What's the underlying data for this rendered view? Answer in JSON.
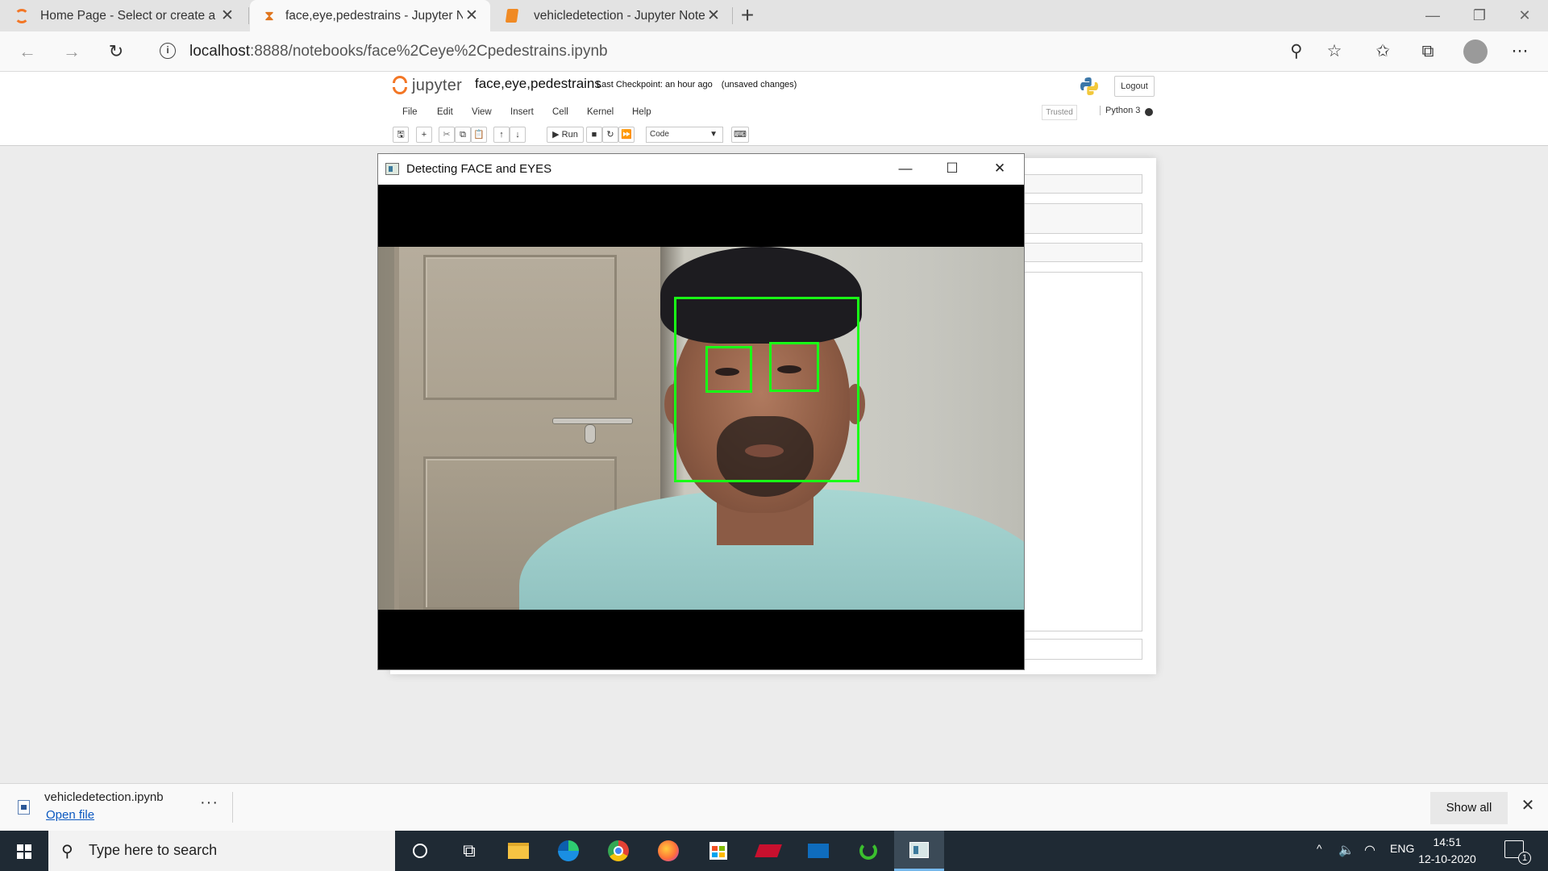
{
  "browser": {
    "tabs": [
      {
        "title": "Home Page - Select or create a n"
      },
      {
        "title": "face,eye,pedestrains - Jupyter Nc"
      },
      {
        "title": "vehicledetection - Jupyter Noteb"
      }
    ],
    "url_host": "localhost",
    "url_rest": ":8888/notebooks/face%2Ceye%2Cpedestrains.ipynb"
  },
  "jupyter": {
    "logo_text": "jupyter",
    "notebook_name": "face,eye,pedestrains",
    "checkpoint_label": "Last Checkpoint:",
    "checkpoint_time": "an hour ago",
    "unsaved": "(unsaved changes)",
    "logout": "Logout",
    "menu": [
      "File",
      "Edit",
      "View",
      "Insert",
      "Cell",
      "Kernel",
      "Help"
    ],
    "trusted": "Trusted",
    "kernel": "Python 3",
    "toolbar": {
      "run": "Run",
      "cell_type": "Code"
    }
  },
  "cv_window": {
    "title": "Detecting FACE and EYES",
    "detection_color": "#19ff16"
  },
  "downloads": {
    "file_name": "vehicledetection.ipynb",
    "open_label": "Open file",
    "show_all": "Show all"
  },
  "taskbar": {
    "search_placeholder": "Type here to search",
    "language": "ENG",
    "time": "14:51",
    "date": "12-10-2020",
    "notification_count": "1"
  }
}
